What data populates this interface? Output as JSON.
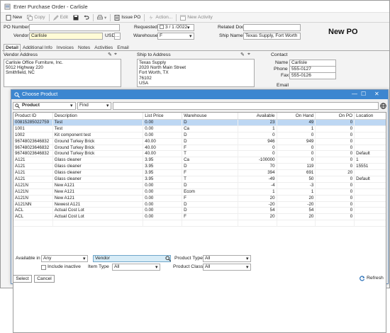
{
  "window": {
    "title": "Enter Purchase Order - Carlisle"
  },
  "toolbar": {
    "new": "New",
    "copy": "Copy",
    "edit": "Edit",
    "issue_po": "Issue PO",
    "action": "Action...",
    "new_activity": "New Activity"
  },
  "header": {
    "po_number_label": "PO Number",
    "po_number": "",
    "vendor_label": "Vendor",
    "vendor": "Carlisle",
    "currency": "USD",
    "requested_label": "Requested",
    "requested": "3 / 1 /2022",
    "warehouse_label": "Warehouse",
    "warehouse": "F",
    "related_doc_label": "Related Doc",
    "related_doc": "",
    "ship_name_label": "Ship Name",
    "ship_name": "Texas Supply, Fort Worth",
    "status_title": "New PO"
  },
  "tabs": [
    "Detail",
    "Additional Info",
    "Invoices",
    "Notes",
    "Activities",
    "Email"
  ],
  "vendor_address": {
    "label": "Vendor Address",
    "line1": "Carlisle Office Furniture, Inc.",
    "line2": "5012 Highway 220",
    "line3": "Smithfield, NC"
  },
  "ship_address": {
    "label": "Ship to Address",
    "line1": "Texas Supply",
    "line2": "2020 North Main Street",
    "line3": "Fort Worth, TX",
    "line4": "76102",
    "line5": "USA"
  },
  "contact": {
    "label": "Contact",
    "name_label": "Name",
    "name": "Carlisle",
    "phone_label": "Phone",
    "phone": "555-0127",
    "fax_label": "Fax",
    "fax": "555-0126",
    "email_label": "Email"
  },
  "dialog": {
    "title": "Choose Product",
    "filter_field": "Product",
    "filter_op": "Find",
    "filter_value": "",
    "columns": [
      "Product ID",
      "Description",
      "List Price",
      "Warehouse",
      "Available",
      "On Hand",
      "On PO",
      "Location"
    ],
    "rows": [
      [
        "00815285022759",
        "Test",
        "0.00",
        "D",
        "23",
        "49",
        "0",
        ""
      ],
      [
        "1001",
        "Test",
        "0.00",
        "Ca",
        "1",
        "1",
        "0",
        ""
      ],
      [
        "1002",
        "Kit component test",
        "0.00",
        "D",
        "0",
        "0",
        "0",
        ""
      ],
      [
        "96748023646832",
        "Ground Turkey Brick",
        "40.00",
        "D",
        "946",
        "949",
        "0",
        ""
      ],
      [
        "96748023646832",
        "Ground Turkey Brick",
        "40.00",
        "F",
        "0",
        "0",
        "0",
        ""
      ],
      [
        "96748023646832",
        "Ground Turkey Brick",
        "40.00",
        "T",
        "0",
        "0",
        "0",
        "Default"
      ],
      [
        "A121",
        "Glass cleaner",
        "3.95",
        "Ca",
        "-100000",
        "0",
        "0",
        "1"
      ],
      [
        "A121",
        "Glass cleaner",
        "3.95",
        "D",
        "70",
        "119",
        "0",
        "15551"
      ],
      [
        "A121",
        "Glass cleaner",
        "3.95",
        "F",
        "394",
        "691",
        "20",
        ""
      ],
      [
        "A121",
        "Glass cleaner",
        "3.95",
        "T",
        "-49",
        "50",
        "0",
        "Default"
      ],
      [
        "A121N",
        "New A121",
        "0.00",
        "D",
        "-4",
        "-3",
        "0",
        ""
      ],
      [
        "A121N",
        "New A121",
        "0.00",
        "Ecom",
        "1",
        "1",
        "0",
        ""
      ],
      [
        "A121N",
        "New A121",
        "0.00",
        "F",
        "20",
        "20",
        "0",
        ""
      ],
      [
        "A121NN",
        "Newest A121",
        "0.00",
        "D",
        "-20",
        "-20",
        "0",
        ""
      ],
      [
        "ACL",
        "Actual Cost Lot",
        "0.00",
        "D",
        "54",
        "54",
        "0",
        ""
      ],
      [
        "ACL",
        "Actual Cost Lot",
        "0.00",
        "F",
        "20",
        "20",
        "0",
        ""
      ],
      [
        "",
        "",
        "",
        "",
        "",
        "",
        "",
        ""
      ]
    ],
    "available_in_label": "Available in",
    "available_in": "Any",
    "include_inactive_label": "Include inactive",
    "vendor_filter": "Vendor",
    "item_type_label": "Item Type",
    "item_type": "All",
    "product_type_label": "Product Type",
    "product_type": "All",
    "product_class_label": "Product Class",
    "product_class": "All",
    "select_label": "Select",
    "cancel_label": "Cancel",
    "refresh_label": "Refresh"
  }
}
